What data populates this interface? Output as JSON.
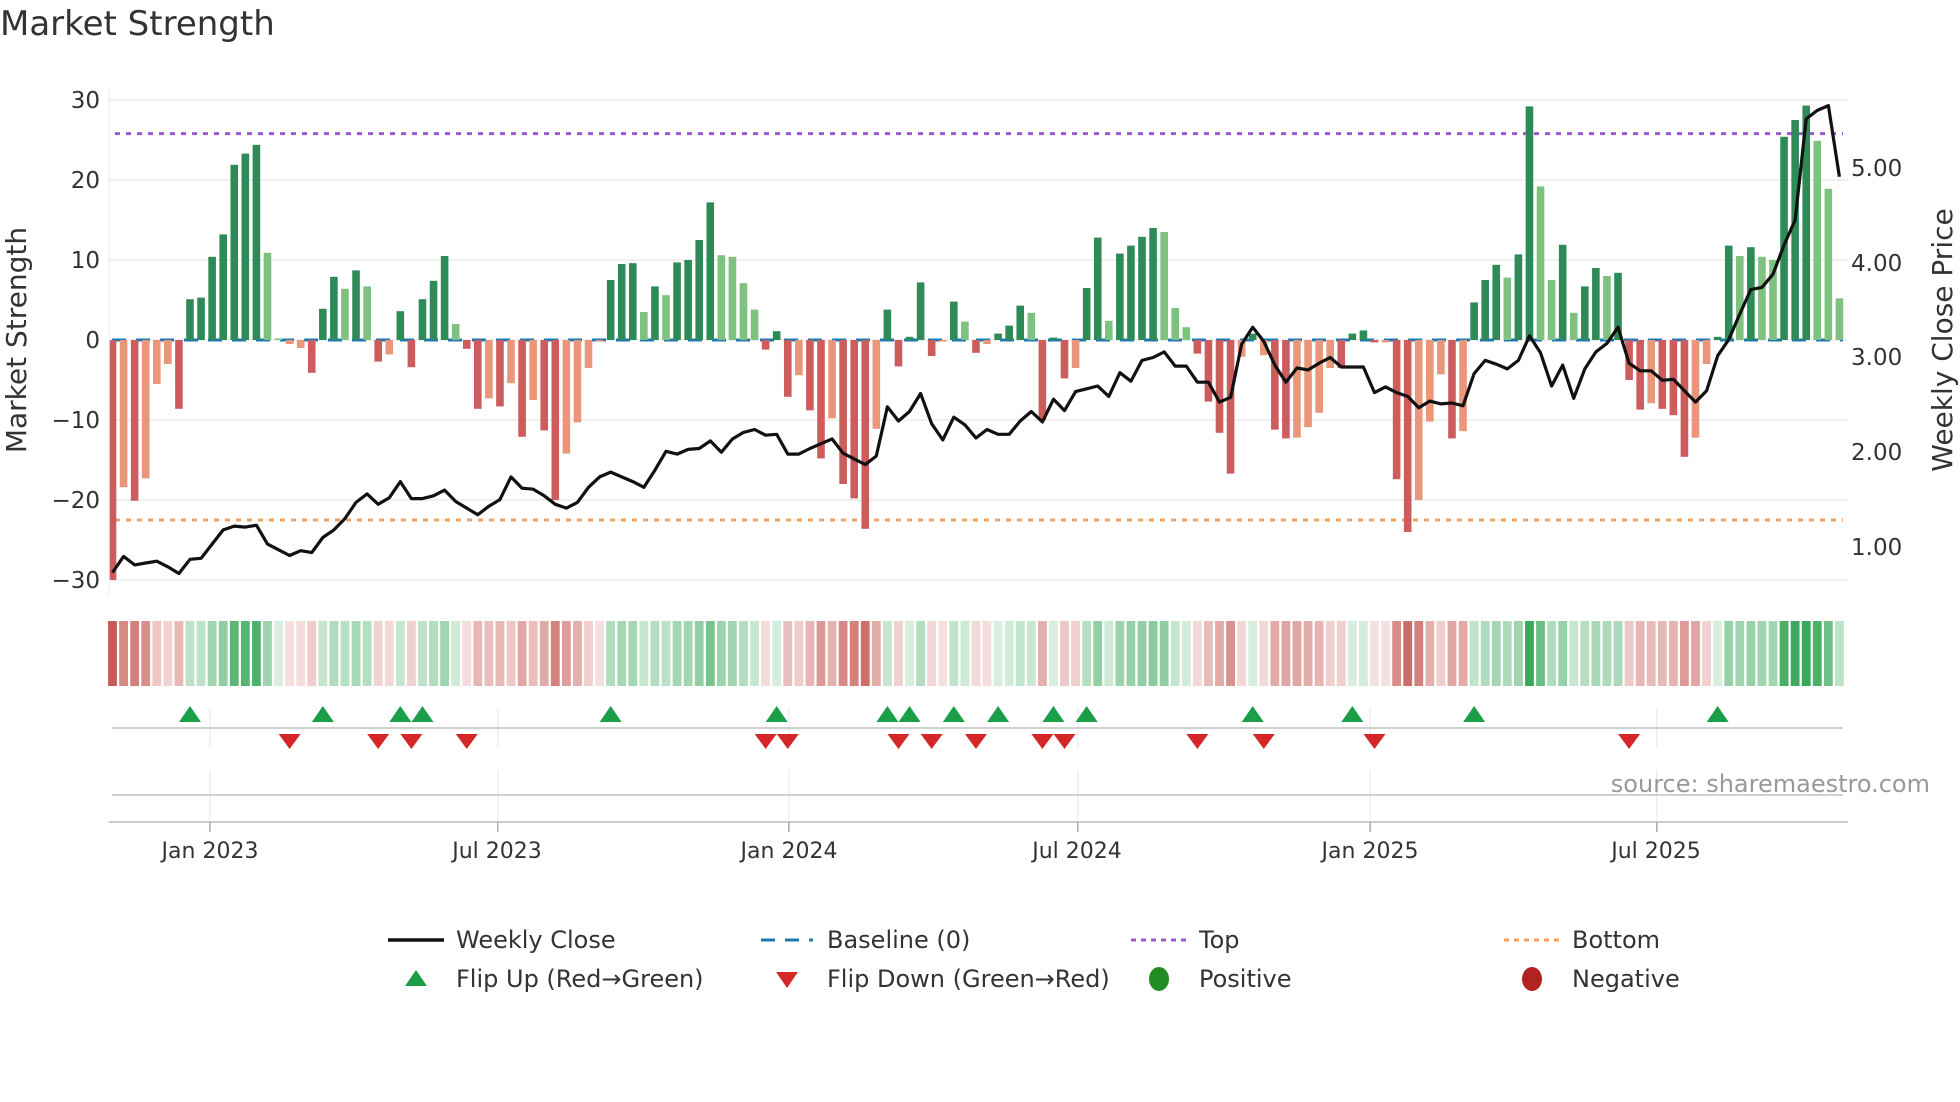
{
  "title": "Market Strength",
  "source": "source: sharemaestro.com",
  "colors": {
    "strong_green": "#2e8b57",
    "weak_green": "#7fc17f",
    "strong_red": "#cd5c5c",
    "weak_red": "#e9967a",
    "baseline": "#1f77b4",
    "top": "#9b59d6",
    "bottom": "#f0a060",
    "flip_up": "#1a9e48",
    "flip_down": "#d62728",
    "positive": "#228b22",
    "negative": "#b22222"
  },
  "legend": {
    "weekly_close": "Weekly Close",
    "baseline": "Baseline (0)",
    "top": "Top",
    "bottom": "Bottom",
    "flip_up": "Flip Up (Red→Green)",
    "flip_down": "Flip Down (Green→Red)",
    "positive": "Positive",
    "negative": "Negative"
  },
  "chart_data": {
    "type": "bar",
    "title": "Market Strength",
    "ylabel": "Market Strength",
    "y2label": "Weekly Close Price",
    "ylim": [
      -30,
      30
    ],
    "y2lim": [
      0.6,
      5.75
    ],
    "yticks": [
      "30",
      "20",
      "10",
      "0",
      "−10",
      "−20",
      "−30"
    ],
    "y2ticks": [
      "5.00",
      "4.00",
      "3.00",
      "2.00",
      "1.00"
    ],
    "xticks": [
      "Jan 2023",
      "Jul 2023",
      "Jan 2024",
      "Jul 2024",
      "Jan 2025",
      "Jul 2025"
    ],
    "xtick_weeks": [
      8.8,
      34.8,
      61.1,
      87.2,
      113.6,
      139.5
    ],
    "top_level": 25.8,
    "bottom_level": -22.5,
    "baseline": 0,
    "strength": [
      -30,
      -18.4,
      -20.1,
      -17.3,
      -5.5,
      -3.0,
      -8.6,
      5.1,
      5.3,
      10.4,
      13.2,
      21.9,
      23.3,
      24.4,
      10.9,
      0.2,
      -0.5,
      -1.0,
      -4.1,
      3.9,
      7.9,
      6.4,
      8.7,
      6.7,
      -2.7,
      -1.8,
      3.6,
      -3.4,
      5.1,
      7.4,
      10.5,
      2.0,
      -1.1,
      -8.6,
      -7.3,
      -8.3,
      -5.4,
      -12.1,
      -7.5,
      -11.3,
      -20,
      -14.2,
      -10.3,
      -3.5,
      -0.2,
      7.5,
      9.5,
      9.6,
      3.5,
      6.7,
      5.6,
      9.7,
      10.0,
      12.5,
      17.2,
      10.6,
      10.4,
      7.1,
      3.8,
      -1.2,
      1.1,
      -7.1,
      -4.4,
      -8.8,
      -14.8,
      -9.8,
      -18.0,
      -19.8,
      -23.6,
      -11.1,
      3.8,
      -3.3,
      0.4,
      7.2,
      -2.0,
      -0.2,
      4.8,
      2.3,
      -1.6,
      -0.5,
      0.8,
      1.8,
      4.3,
      3.4,
      -10.0,
      0.3,
      -4.8,
      -3.5,
      6.5,
      12.8,
      2.4,
      10.8,
      11.8,
      12.9,
      14.0,
      13.5,
      4.0,
      1.6,
      -1.7,
      -7.7,
      -11.6,
      -16.7,
      -2.1,
      0.8,
      -1.9,
      -11.2,
      -12.3,
      -12.2,
      -10.9,
      -9.1,
      -3.5,
      -3.5,
      0.8,
      1.2,
      -0.3,
      -0.3,
      -17.4,
      -24.0,
      -20.0,
      -10.2,
      -4.3,
      -12.3,
      -11.4,
      4.7,
      7.5,
      9.4,
      7.8,
      10.7,
      29.2,
      19.2,
      7.5,
      11.9,
      3.4,
      6.7,
      9.0,
      8.0,
      8.4,
      -5.0,
      -8.7,
      -7.9,
      -8.6,
      -9.4,
      -14.6,
      -12.2,
      -3.0,
      0.4,
      11.8,
      10.5,
      11.6,
      10.4,
      10.0,
      25.4,
      27.5,
      29.3,
      24.9,
      18.9,
      5.2
    ],
    "strength_tone": "RrRrrrRGGGGGGGggrrRGGgGgRrGRGGGgRRrRrRrRRrrrrGGGgGgGGGGggggRGRrRRrRRRrGRGGRrGgRrGGGgRGRrGGgGGGGgggRRRRrGrRRrrrrRGGRrRRrrrRrGGGgGGggGgGGgGRRrRRRrrGGgGggGGGggg",
    "weekly_close": [
      0.72,
      0.89,
      0.8,
      0.82,
      0.84,
      0.78,
      0.71,
      0.86,
      0.87,
      1.02,
      1.17,
      1.21,
      1.2,
      1.22,
      1.02,
      0.96,
      0.9,
      0.95,
      0.93,
      1.09,
      1.17,
      1.29,
      1.46,
      1.55,
      1.44,
      1.51,
      1.68,
      1.5,
      1.5,
      1.53,
      1.59,
      1.47,
      1.4,
      1.33,
      1.42,
      1.49,
      1.73,
      1.61,
      1.6,
      1.53,
      1.44,
      1.4,
      1.46,
      1.62,
      1.73,
      1.78,
      1.73,
      1.68,
      1.62,
      1.8,
      2.0,
      1.97,
      2.02,
      2.03,
      2.11,
      1.99,
      2.13,
      2.2,
      2.23,
      2.17,
      2.18,
      1.97,
      1.97,
      2.03,
      2.08,
      2.13,
      1.98,
      1.92,
      1.86,
      1.95,
      2.47,
      2.32,
      2.42,
      2.61,
      2.29,
      2.12,
      2.36,
      2.28,
      2.14,
      2.23,
      2.18,
      2.18,
      2.32,
      2.42,
      2.31,
      2.55,
      2.43,
      2.63,
      2.66,
      2.69,
      2.58,
      2.83,
      2.74,
      2.96,
      2.99,
      3.05,
      2.9,
      2.9,
      2.73,
      2.73,
      2.52,
      2.57,
      3.13,
      3.31,
      3.16,
      2.91,
      2.73,
      2.88,
      2.86,
      2.93,
      2.99,
      2.89,
      2.89,
      2.89,
      2.62,
      2.68,
      2.62,
      2.58,
      2.46,
      2.53,
      2.5,
      2.51,
      2.48,
      2.82,
      2.96,
      2.92,
      2.87,
      2.96,
      3.22,
      3.04,
      2.69,
      2.91,
      2.56,
      2.87,
      3.05,
      3.14,
      3.31,
      2.93,
      2.85,
      2.85,
      2.75,
      2.76,
      2.64,
      2.52,
      2.64,
      3.01,
      3.18,
      3.45,
      3.71,
      3.73,
      3.87,
      4.18,
      4.44,
      5.51,
      5.6,
      5.65,
      4.9
    ],
    "flip_up_weeks": [
      7,
      19,
      26,
      28,
      45,
      60,
      70,
      72,
      76,
      80,
      85,
      88,
      103,
      112,
      123,
      145
    ],
    "flip_down_weeks": [
      16,
      24,
      27,
      32,
      59,
      61,
      71,
      74,
      78,
      84,
      86,
      98,
      104,
      114,
      137
    ],
    "legend_position": "bottom"
  }
}
